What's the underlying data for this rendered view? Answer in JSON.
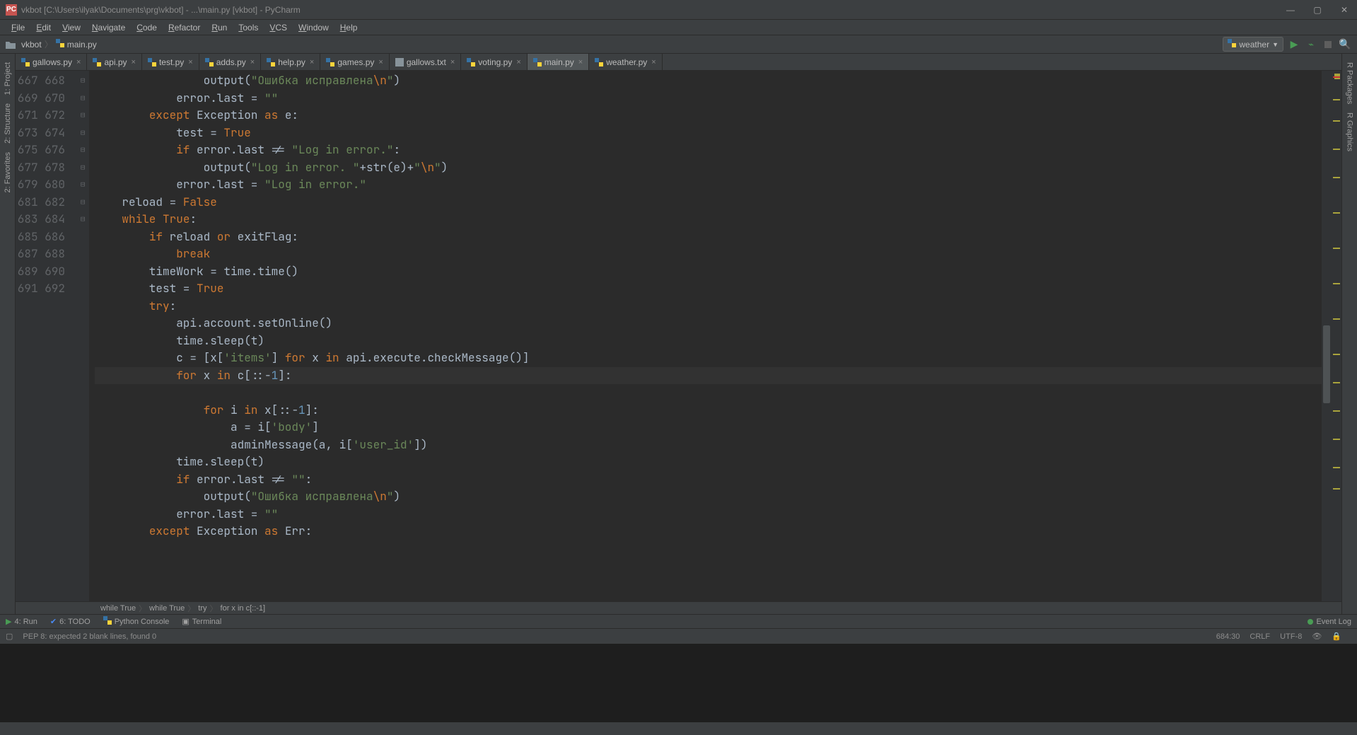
{
  "window": {
    "title": "vkbot [C:\\Users\\ilyak\\Documents\\prg\\vkbot] - ...\\main.py [vkbot] - PyCharm",
    "app_icon_text": "PC"
  },
  "menu": [
    "File",
    "Edit",
    "View",
    "Navigate",
    "Code",
    "Refactor",
    "Run",
    "Tools",
    "VCS",
    "Window",
    "Help"
  ],
  "nav": {
    "project_folder": "vkbot",
    "current_file": "main.py",
    "run_config": "weather"
  },
  "left_tabs": [
    "1: Project",
    "2: Structure",
    "2: Favorites"
  ],
  "right_tabs": [
    "R Packages",
    "R Graphics"
  ],
  "file_tabs": [
    {
      "name": "gallows.py",
      "type": "py",
      "active": false
    },
    {
      "name": "api.py",
      "type": "py",
      "active": false
    },
    {
      "name": "test.py",
      "type": "py",
      "active": false
    },
    {
      "name": "adds.py",
      "type": "py",
      "active": false
    },
    {
      "name": "help.py",
      "type": "py",
      "active": false
    },
    {
      "name": "games.py",
      "type": "py",
      "active": false
    },
    {
      "name": "gallows.txt",
      "type": "txt",
      "active": false
    },
    {
      "name": "voting.py",
      "type": "py",
      "active": false
    },
    {
      "name": "main.py",
      "type": "py",
      "active": true
    },
    {
      "name": "weather.py",
      "type": "py",
      "active": false
    }
  ],
  "line_start": 667,
  "line_end": 692,
  "code_lines": [
    "                output(\"Ошибка исправлена\\n\")",
    "            error.last = \"\"",
    "        except Exception as e:",
    "            test = True",
    "            if error.last != \"Log in error.\":",
    "                output(\"Log in error. \"+str(e)+\"\\n\")",
    "            error.last = \"Log in error.\"",
    "    reload = False",
    "    while True:",
    "        if reload or exitFlag:",
    "            break",
    "        timeWork = time.time()",
    "        test = True",
    "        try:",
    "            api.account.setOnline()",
    "            time.sleep(t)",
    "            c = [x['items'] for x in api.execute.checkMessage()]",
    "            for x in c[::-1]:",
    "                for i in x[::-1]:",
    "                    a = i['body']",
    "                    adminMessage(a, i['user_id'])",
    "            time.sleep(t)",
    "            if error.last != \"\":",
    "                output(\"Ошибка исправлена\\n\")",
    "            error.last = \"\"",
    "        except Exception as Err:"
  ],
  "current_line_index": 17,
  "breadcrumb": [
    "while True",
    "while True",
    "try",
    "for x in c[::-1]"
  ],
  "tool_windows": [
    {
      "name": "4: Run",
      "icon": "run"
    },
    {
      "name": "6: TODO",
      "icon": "check"
    },
    {
      "name": "Python Console",
      "icon": "py"
    },
    {
      "name": "Terminal",
      "icon": "term"
    }
  ],
  "event_log": "Event Log",
  "status": {
    "hint": "PEP 8: expected 2 blank lines, found 0",
    "pos": "684:30",
    "line_end": "CRLF",
    "encoding": "UTF-8",
    "insp": "⬚"
  }
}
